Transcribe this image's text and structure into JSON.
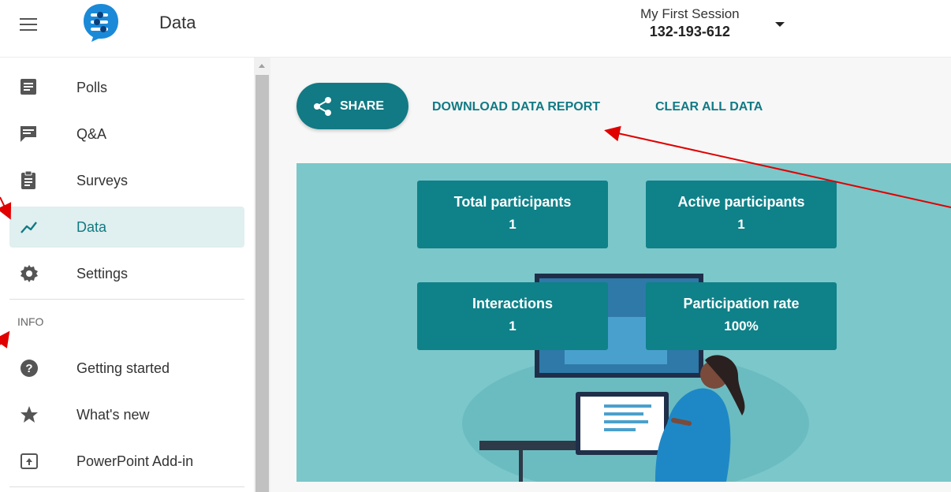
{
  "header": {
    "title": "Data",
    "session_name": "My First Session",
    "session_code": "132-193-612"
  },
  "sidebar": {
    "items": [
      {
        "label": "Polls",
        "icon": "poll-icon"
      },
      {
        "label": "Q&A",
        "icon": "qa-icon"
      },
      {
        "label": "Surveys",
        "icon": "survey-icon"
      },
      {
        "label": "Data",
        "icon": "trend-icon",
        "active": true
      },
      {
        "label": "Settings",
        "icon": "gear-icon"
      }
    ],
    "info_header": "INFO",
    "info_items": [
      {
        "label": "Getting started",
        "icon": "help-icon"
      },
      {
        "label": "What's new",
        "icon": "star-icon"
      },
      {
        "label": "PowerPoint Add-in",
        "icon": "upload-icon"
      }
    ]
  },
  "toolbar": {
    "share_label": "SHARE",
    "download_label": "DOWNLOAD DATA REPORT",
    "clear_label": "CLEAR ALL DATA"
  },
  "stats": [
    {
      "label": "Total participants",
      "value": "1"
    },
    {
      "label": "Active participants",
      "value": "1"
    },
    {
      "label": "Interactions",
      "value": "1"
    },
    {
      "label": "Participation rate",
      "value": "100%"
    }
  ],
  "colors": {
    "accent": "#117a84",
    "panel_bg": "#7cc7ca",
    "stat_card": "#0f8189",
    "annotation_arrow": "#e00000"
  }
}
